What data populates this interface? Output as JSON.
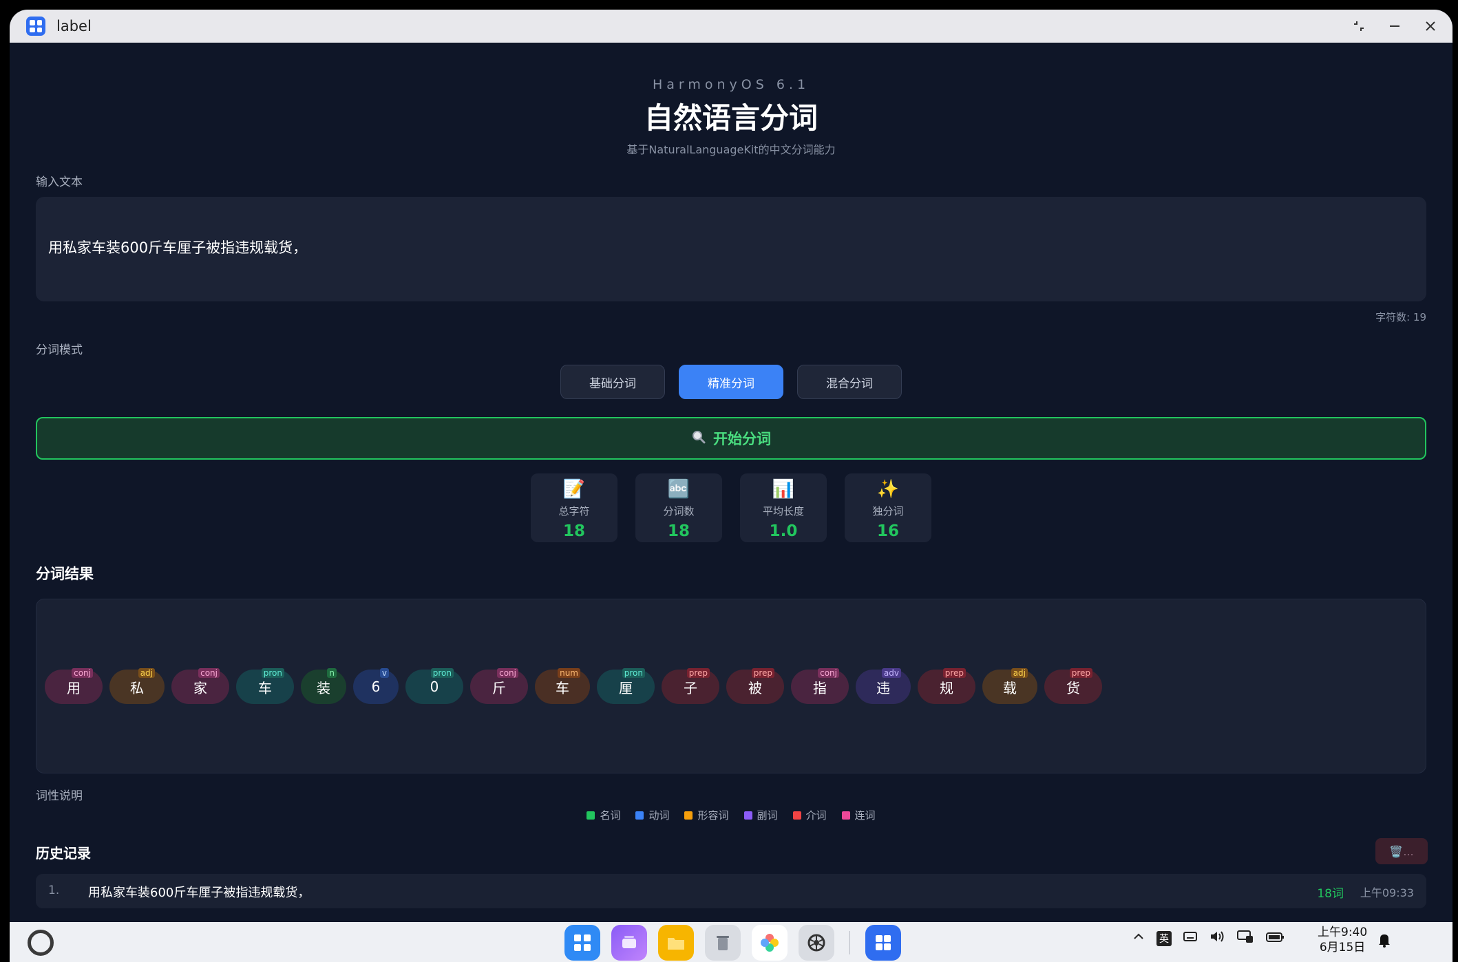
{
  "window": {
    "title": "label"
  },
  "header": {
    "os": "HarmonyOS 6.1",
    "title": "自然语言分词",
    "subtitle": "基于NaturalLanguageKit的中文分词能力"
  },
  "input": {
    "label": "输入文本",
    "value": "用私家车装600斤车厘子被指违规载货，",
    "char_count": "字符数: 19"
  },
  "mode": {
    "label": "分词模式",
    "options": [
      "基础分词",
      "精准分词",
      "混合分词"
    ],
    "selected": "精准分词"
  },
  "start_button": {
    "label": "开始分词"
  },
  "stats": [
    {
      "icon": "memo-icon",
      "glyph": "📝",
      "label": "总字符",
      "value": "18"
    },
    {
      "icon": "abc-icon",
      "glyph": "🔤",
      "label": "分词数",
      "value": "18"
    },
    {
      "icon": "bar-chart-icon",
      "glyph": "📊",
      "label": "平均长度",
      "value": "1.0"
    },
    {
      "icon": "sparkles-icon",
      "glyph": "✨",
      "label": "独分词",
      "value": "16"
    }
  ],
  "results": {
    "title": "分词结果",
    "tokens": [
      {
        "text": "用",
        "pos": "conj"
      },
      {
        "text": "私",
        "pos": "adj"
      },
      {
        "text": "家",
        "pos": "conj"
      },
      {
        "text": "车",
        "pos": "pron"
      },
      {
        "text": "装",
        "pos": "n"
      },
      {
        "text": "6",
        "pos": "v"
      },
      {
        "text": "0",
        "pos": "pron"
      },
      {
        "text": "斤",
        "pos": "conj"
      },
      {
        "text": "车",
        "pos": "num"
      },
      {
        "text": "厘",
        "pos": "pron"
      },
      {
        "text": "子",
        "pos": "prep"
      },
      {
        "text": "被",
        "pos": "prep"
      },
      {
        "text": "指",
        "pos": "conj"
      },
      {
        "text": "违",
        "pos": "adv"
      },
      {
        "text": "规",
        "pos": "prep"
      },
      {
        "text": "载",
        "pos": "adj"
      },
      {
        "text": "货",
        "pos": "prep"
      }
    ]
  },
  "legend": {
    "label": "词性说明",
    "items": [
      {
        "label": "名词",
        "color": "#22c55e"
      },
      {
        "label": "动词",
        "color": "#3b82f6"
      },
      {
        "label": "形容词",
        "color": "#f59e0b"
      },
      {
        "label": "副词",
        "color": "#8b5cf6"
      },
      {
        "label": "介词",
        "color": "#ef4444"
      },
      {
        "label": "连词",
        "color": "#ec4899"
      }
    ]
  },
  "history": {
    "title": "历史记录",
    "clear_label": "🗑️...",
    "items": [
      {
        "index": "1.",
        "text": "用私家车装600斤车厘子被指违规载货，",
        "count": "18词",
        "time": "上午09:33"
      }
    ]
  },
  "taskbar": {
    "ime": "英",
    "time": "上午9:40",
    "date": "6月15日"
  },
  "colors": {
    "accent": "#3b82f6",
    "success": "#22c55e",
    "background": "#0f1628"
  }
}
